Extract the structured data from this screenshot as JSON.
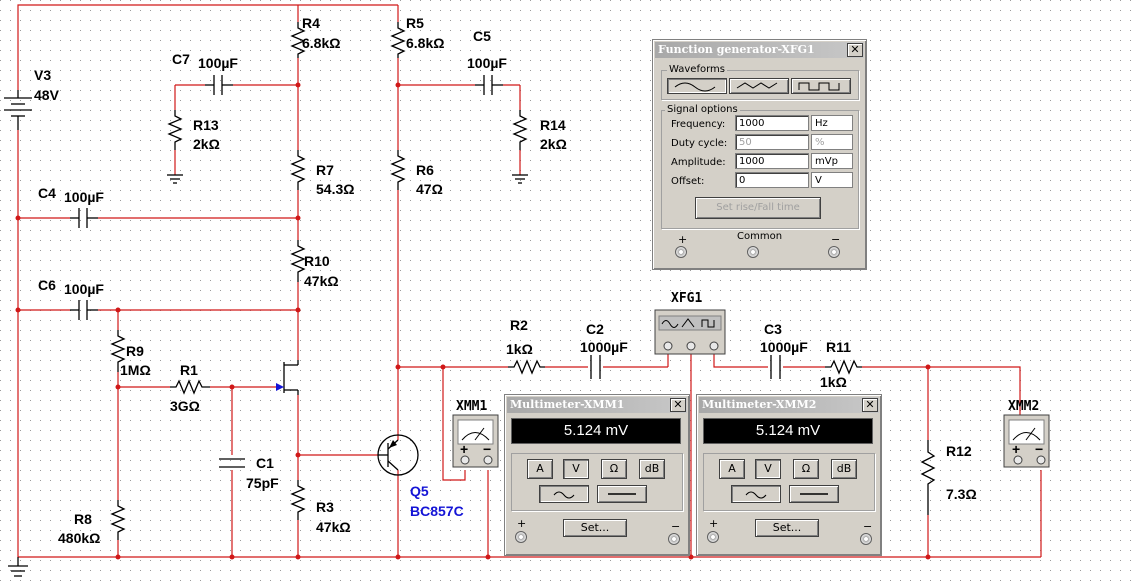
{
  "components": {
    "v3": {
      "ref": "V3",
      "value": "48V"
    },
    "r4": {
      "ref": "R4",
      "value": "6.8kΩ"
    },
    "r5": {
      "ref": "R5",
      "value": "6.8kΩ"
    },
    "c5": {
      "ref": "C5",
      "value": "100µF"
    },
    "c7": {
      "ref": "C7",
      "value": "100µF"
    },
    "r13": {
      "ref": "R13",
      "value": "2kΩ"
    },
    "r14": {
      "ref": "R14",
      "value": "2kΩ"
    },
    "r7": {
      "ref": "R7",
      "value": "54.3Ω"
    },
    "r6": {
      "ref": "R6",
      "value": "47Ω"
    },
    "c4": {
      "ref": "C4",
      "value": "100µF"
    },
    "r10": {
      "ref": "R10",
      "value": "47kΩ"
    },
    "c6": {
      "ref": "C6",
      "value": "100µF"
    },
    "r9": {
      "ref": "R9",
      "value": "1MΩ"
    },
    "r1": {
      "ref": "R1",
      "value": "3GΩ"
    },
    "c1": {
      "ref": "C1",
      "value": "75pF"
    },
    "r8": {
      "ref": "R8",
      "value": "480kΩ"
    },
    "r3": {
      "ref": "R3",
      "value": "47kΩ"
    },
    "q5": {
      "ref": "Q5",
      "value": "BC857C"
    },
    "r2": {
      "ref": "R2",
      "value": "1kΩ"
    },
    "c2": {
      "ref": "C2",
      "value": "1000µF"
    },
    "c3": {
      "ref": "C3",
      "value": "1000µF"
    },
    "r11": {
      "ref": "R11",
      "value": "1kΩ"
    },
    "r12": {
      "ref": "R12",
      "value": "7.3Ω"
    },
    "xfg1": {
      "ref": "XFG1"
    },
    "xmm1": {
      "ref": "XMM1"
    },
    "xmm2": {
      "ref": "XMM2"
    }
  },
  "function_generator": {
    "title": "Function generator-XFG1",
    "close": "✕",
    "waveforms_label": "Waveforms",
    "signal_options_label": "Signal options",
    "selected_waveform": "sine",
    "rows": [
      {
        "label": "Frequency:",
        "value": "1000",
        "unit": "Hz",
        "enabled": true
      },
      {
        "label": "Duty cycle:",
        "value": "50",
        "unit": "%",
        "enabled": false
      },
      {
        "label": "Amplitude:",
        "value": "1000",
        "unit": "mVp",
        "enabled": true
      },
      {
        "label": "Offset:",
        "value": "0",
        "unit": "V",
        "enabled": true
      }
    ],
    "rise_fall_button": "Set rise/Fall time",
    "plus": "+",
    "common": "Common",
    "minus": "−"
  },
  "multimeter1": {
    "title": "Multimeter-XMM1",
    "close": "✕",
    "reading": "5.124 mV",
    "modes": [
      "A",
      "V",
      "Ω",
      "dB"
    ],
    "selected_mode": "V",
    "set_button": "Set...",
    "plus": "+",
    "minus": "−"
  },
  "multimeter2": {
    "title": "Multimeter-XMM2",
    "close": "✕",
    "reading": "5.124 mV",
    "modes": [
      "A",
      "V",
      "Ω",
      "dB"
    ],
    "selected_mode": "V",
    "set_button": "Set...",
    "plus": "+",
    "minus": "−"
  },
  "meter_pins": {
    "plus": "+",
    "minus": "−"
  },
  "colors": {
    "wire": "#d01818",
    "transistor_label": "#1414d6",
    "grid_dot": "#9a9a9a",
    "panel": "#d4d0c8"
  }
}
